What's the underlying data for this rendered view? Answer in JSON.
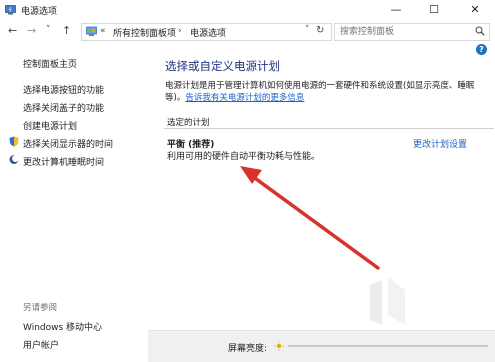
{
  "window": {
    "title": "电源选项",
    "minimize_glyph": "—",
    "maximize_glyph": "☐",
    "close_glyph": "✕"
  },
  "nav": {
    "back_glyph": "←",
    "forward_glyph": "→",
    "recent_glyph": "˅",
    "up_glyph": "↑",
    "breadcrumb_sep": "«",
    "crumb_separator": "›",
    "crumbs": [
      "所有控制面板项",
      "电源选项"
    ],
    "address_dropdown_glyph": "˅",
    "refresh_glyph": "↻",
    "search_placeholder": "搜索控制面板"
  },
  "help_glyph": "?",
  "sidebar": {
    "items": [
      {
        "label": "控制面板主页",
        "has_icon": false
      },
      {
        "label": "选择电源按钮的功能",
        "has_icon": false
      },
      {
        "label": "选择关闭盖子的功能",
        "has_icon": false
      },
      {
        "label": "创建电源计划",
        "has_icon": false
      },
      {
        "label": "选择关闭显示器的时间",
        "has_icon": true,
        "icon": "shield-icon"
      },
      {
        "label": "更改计算机睡眠时间",
        "has_icon": true,
        "icon": "moon-icon"
      }
    ],
    "see_also_title": "另请参阅",
    "see_also": [
      "Windows 移动中心",
      "用户帐户"
    ]
  },
  "main": {
    "heading": "选择或自定义电源计划",
    "description": "电源计划是用于管理计算机如何使用电源的一套硬件和系统设置(如显示亮度、睡眠等)。",
    "description_link": "告诉我有关电源计划的更多信息",
    "group_label": "选定的计划",
    "plan_name": "平衡 (推荐)",
    "plan_desc": "利用可用的硬件自动平衡功耗与性能。",
    "change_plan_link": "更改计划设置"
  },
  "bottom": {
    "brightness_label": "屏幕亮度:"
  },
  "colors": {
    "heading": "#1e3287",
    "link": "#1a62c8",
    "annotation_arrow": "#d9312b"
  }
}
